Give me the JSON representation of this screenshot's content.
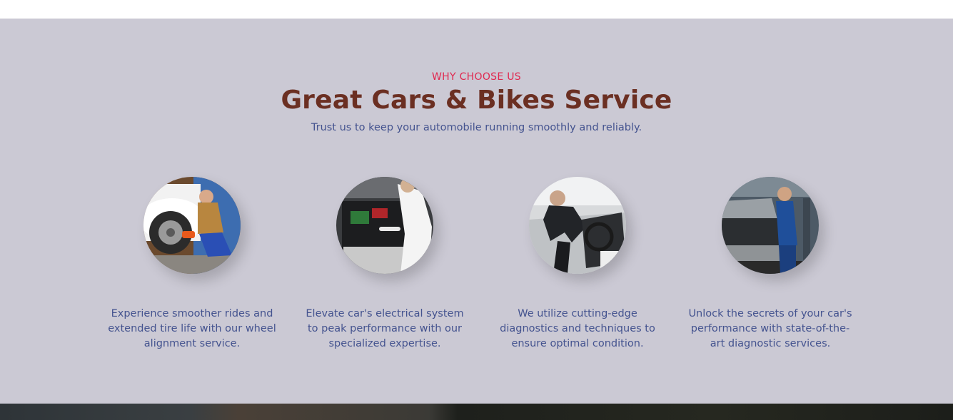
{
  "section": {
    "eyebrow": "WHY CHOOSE US",
    "title": "Great Cars & Bikes Service",
    "subtitle": "Trust us to keep your automobile running smoothly and reliably."
  },
  "features": [
    {
      "image": "wheel-alignment-photo",
      "text": "Experience smoother rides and extended tire life with our wheel alignment service."
    },
    {
      "image": "electrical-system-photo",
      "text": "Elevate car's electrical system to peak performance with our specialized expertise."
    },
    {
      "image": "car-diagnostics-photo",
      "text": "We utilize cutting-edge diagnostics and techniques to ensure optimal condition."
    },
    {
      "image": "engine-diagnostic-photo",
      "text": "Unlock the secrets of your car's performance with state-of-the-art diagnostic services."
    }
  ],
  "colors": {
    "section_bg": "#cbc9d4",
    "eyebrow": "#e0284f",
    "title": "#6b2f22",
    "body_text": "#44538f"
  }
}
